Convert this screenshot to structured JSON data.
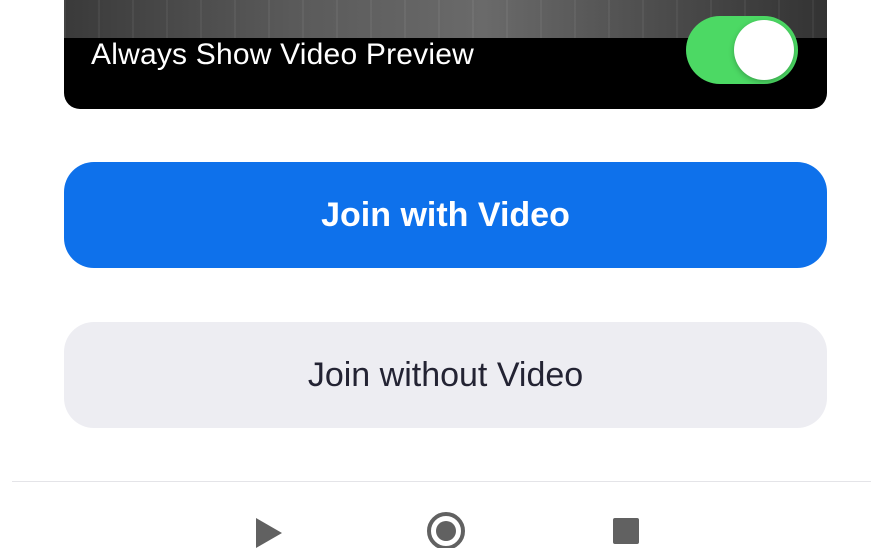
{
  "preview": {
    "label": "Always Show Video Preview",
    "toggle_on": true,
    "toggle_color": "#4cd964"
  },
  "actions": {
    "join_with_video": "Join with Video",
    "join_without_video": "Join without Video",
    "primary_color": "#0e71eb",
    "secondary_color": "#ededf2"
  },
  "nav_bar": {
    "back_icon": "triangle-back-icon",
    "home_icon": "circle-home-icon",
    "recents_icon": "square-recents-icon"
  }
}
